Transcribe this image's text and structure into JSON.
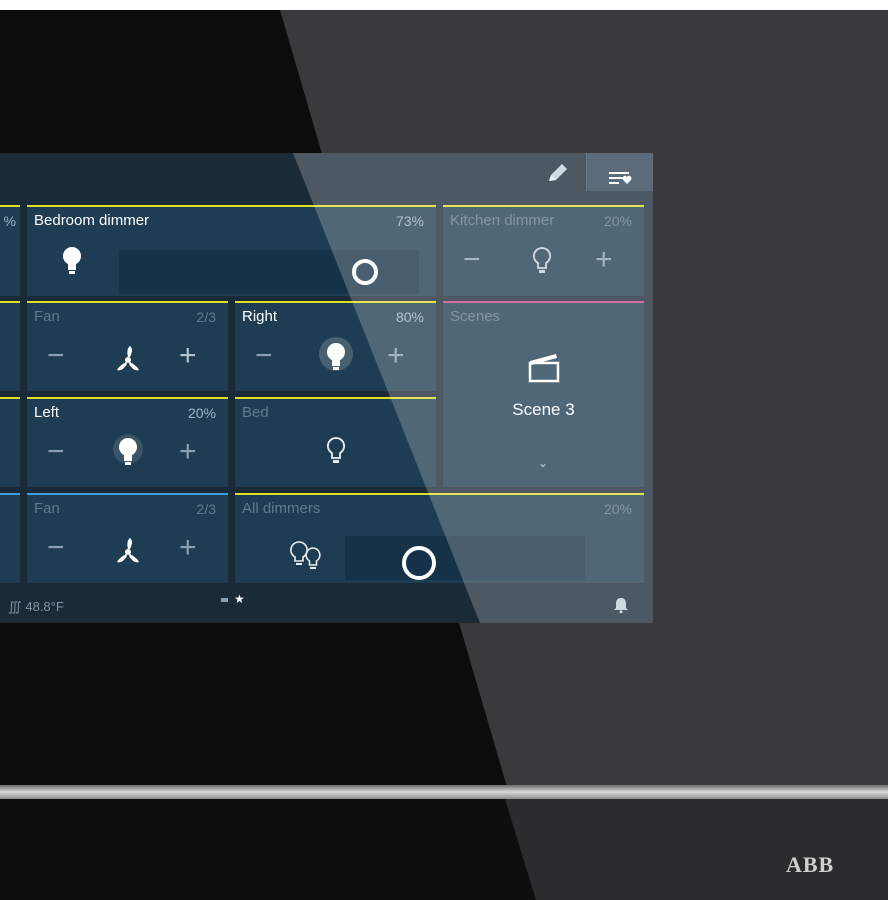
{
  "brand": "ABB",
  "status": {
    "temperature": "48.8°F"
  },
  "tiles": {
    "bedroom_dimmer": {
      "label": "Bedroom dimmer",
      "value": "73%",
      "level": 0.73
    },
    "kitchen_dimmer": {
      "label": "Kitchen dimmer",
      "value": "20%",
      "minus": "−",
      "plus": "+"
    },
    "fan_top": {
      "label": "Fan",
      "value": "2/3",
      "minus": "−",
      "plus": "+"
    },
    "right": {
      "label": "Right",
      "value": "80%",
      "minus": "−",
      "plus": "+"
    },
    "scenes": {
      "label": "Scenes",
      "scene": "Scene 3",
      "chevron": "⌄"
    },
    "left": {
      "label": "Left",
      "value": "20%",
      "minus": "−",
      "plus": "+"
    },
    "bed": {
      "label": "Bed"
    },
    "fan_bottom": {
      "label": "Fan",
      "value": "2/3",
      "minus": "−",
      "plus": "+"
    },
    "all_dimmers": {
      "label": "All dimmers",
      "value": "20%",
      "level": 0.2
    },
    "partial_top": {
      "value": "%"
    }
  },
  "pager": {
    "star": "★"
  },
  "icons": [
    "pencil-icon",
    "favorites-menu-icon",
    "bulb-icon",
    "fan-icon",
    "clapperboard-icon",
    "bulbs-icon",
    "bell-icon",
    "heating-icon"
  ],
  "colors": {
    "accent_yellow": "#d9e021",
    "accent_pink": "#c8457e",
    "accent_blue": "#3b9fe0",
    "tile": "#1f3d52"
  }
}
